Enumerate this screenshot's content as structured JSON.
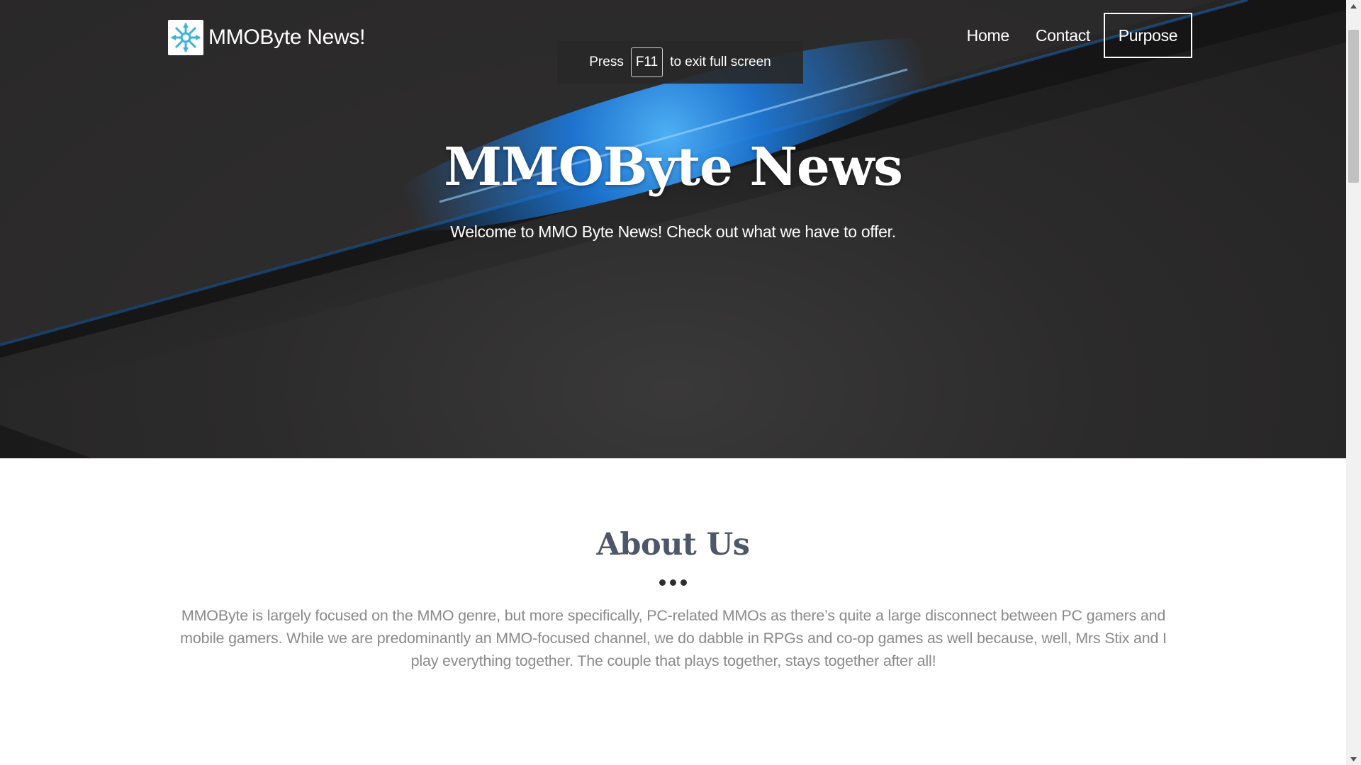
{
  "header": {
    "brand_name": "MMOByte News!",
    "logo_icon": "snowflake-logo-icon",
    "nav": {
      "home": "Home",
      "contact": "Contact",
      "purpose": "Purpose"
    }
  },
  "fullscreen_notice": {
    "prefix": "Press",
    "key": "F11",
    "suffix": "to exit full screen"
  },
  "hero": {
    "title": "MMOByte News",
    "subtitle": "Welcome to MMO Byte News! Check out what we have to offer."
  },
  "about": {
    "title": "About Us",
    "body": "MMOByte is largely focused on the MMO genre, but more specifically, PC-related MMOs as there’s quite a large disconnect between PC gamers and mobile gamers. While we are predominantly an MMO-focused channel, we do dabble in RPGs and co-op games as well because, well, Mrs Stix and I play everything together. The couple that plays together, stays together after all!"
  },
  "colors": {
    "hero_background": "#2c2b2b",
    "accent_glow": "#1e90ff",
    "about_title": "#4e5669",
    "body_text": "#8a8a8a"
  }
}
